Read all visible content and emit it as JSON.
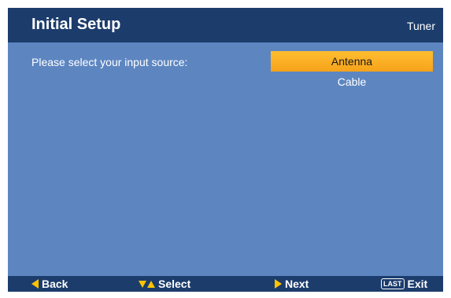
{
  "header": {
    "title": "Initial Setup",
    "section": "Tuner"
  },
  "prompt": "Please select your input source:",
  "options": [
    {
      "label": "Antenna",
      "selected": true
    },
    {
      "label": "Cable",
      "selected": false
    }
  ],
  "footer": {
    "back_label": "Back",
    "select_label": "Select",
    "next_label": "Next",
    "last_key": "LAST",
    "exit_label": "Exit"
  },
  "colors": {
    "background": "#5d86c1",
    "bar": "#1c3c6c",
    "highlight": "#f6a21b",
    "arrow": "#ffc400"
  }
}
